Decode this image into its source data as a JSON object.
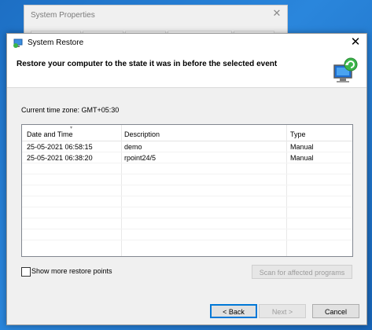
{
  "background_window": {
    "title": "System Properties"
  },
  "dialog": {
    "title": "System Restore",
    "heading": "Restore your computer to the state it was in before the selected event",
    "timezone_label": "Current time zone: GMT+05:30",
    "columns": [
      "Date and Time",
      "Description",
      "Type"
    ],
    "rows": [
      {
        "date": "25-05-2021 06:58:15",
        "description": "demo",
        "type": "Manual"
      },
      {
        "date": "25-05-2021 06:38:20",
        "description": "rpoint24/5",
        "type": "Manual"
      }
    ],
    "show_more_label": "Show more restore points",
    "show_more_checked": false,
    "scan_button": "Scan for affected programs",
    "back_button": "< Back",
    "next_button": "Next >",
    "cancel_button": "Cancel"
  },
  "colors": {
    "desktop": "#1a73c9",
    "accent": "#0078d7"
  },
  "icons": [
    "system-restore-icon",
    "close-icon",
    "system-restore-hero-icon",
    "sort-indicator-icon"
  ]
}
